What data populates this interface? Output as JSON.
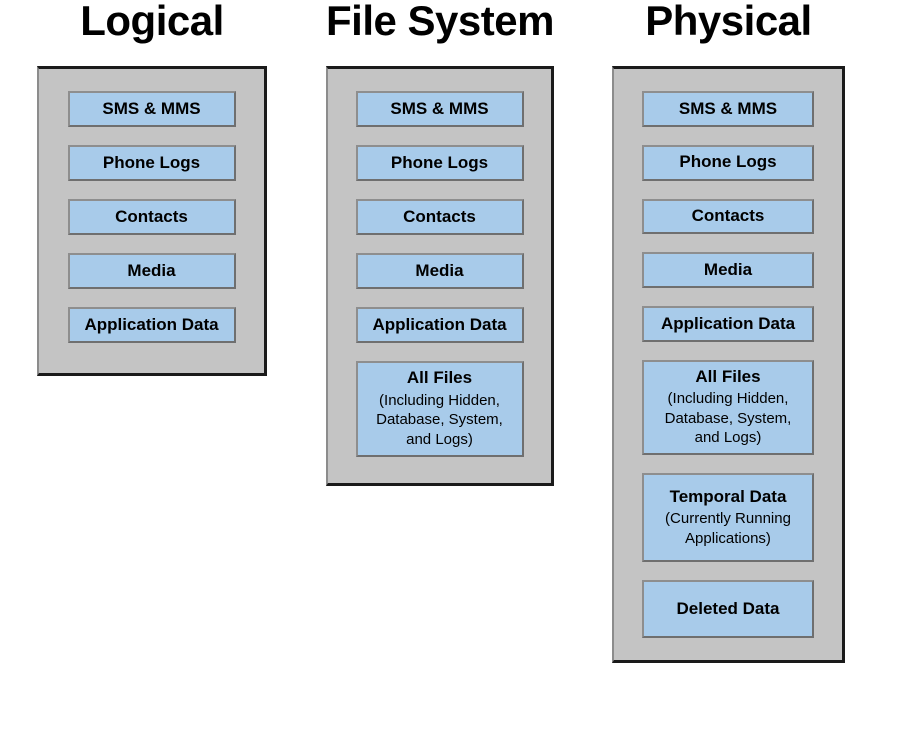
{
  "diagram": {
    "columns": [
      {
        "id": "logical",
        "title": "Logical",
        "items": [
          {
            "main": "SMS & MMS"
          },
          {
            "main": "Phone Logs"
          },
          {
            "main": "Contacts"
          },
          {
            "main": "Media"
          },
          {
            "main": "Application Data"
          }
        ]
      },
      {
        "id": "file-system",
        "title": "File System",
        "items": [
          {
            "main": "SMS & MMS"
          },
          {
            "main": "Phone Logs"
          },
          {
            "main": "Contacts"
          },
          {
            "main": "Media"
          },
          {
            "main": "Application Data"
          },
          {
            "main": "All Files",
            "sub_lines": [
              "(Including Hidden,",
              "Database, System,",
              "and Logs)"
            ]
          }
        ]
      },
      {
        "id": "physical",
        "title": "Physical",
        "items": [
          {
            "main": "SMS & MMS"
          },
          {
            "main": "Phone Logs"
          },
          {
            "main": "Contacts"
          },
          {
            "main": "Media"
          },
          {
            "main": "Application Data"
          },
          {
            "main": "All Files",
            "sub_lines": [
              "(Including Hidden,",
              "Database, System,",
              "and Logs)"
            ]
          },
          {
            "main": "Temporal Data",
            "sub_lines": [
              "(Currently Running",
              "Applications)"
            ]
          },
          {
            "main": "Deleted Data"
          }
        ]
      }
    ]
  },
  "colors": {
    "item_fill": "#a8cbea",
    "panel_fill": "#c4c4c4",
    "panel_border": "#1a1a1a",
    "item_border": "#7d7d7d",
    "text": "#000000",
    "background": "#ffffff"
  }
}
